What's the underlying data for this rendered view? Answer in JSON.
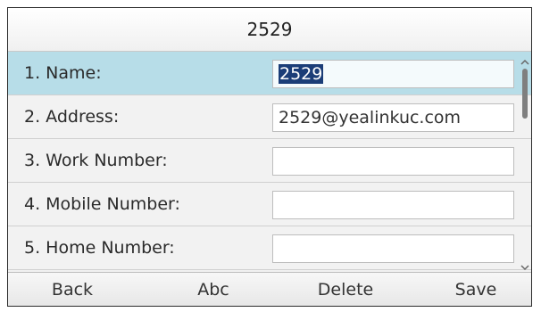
{
  "header": {
    "title": "2529"
  },
  "form": {
    "rows": [
      {
        "label": "1. Name:",
        "value": "2529",
        "selected": true
      },
      {
        "label": "2. Address:",
        "value": "2529@yealinkuc.com"
      },
      {
        "label": "3. Work Number:",
        "value": ""
      },
      {
        "label": "4. Mobile Number:",
        "value": ""
      },
      {
        "label": "5. Home Number:",
        "value": ""
      }
    ]
  },
  "softkeys": {
    "back": "Back",
    "abc": "Abc",
    "delete": "Delete",
    "save": "Save"
  },
  "scroll": {
    "up_icon": "chevron-up-icon",
    "down_icon": "chevron-down-icon"
  },
  "colors": {
    "selected_row": "#b7dde8",
    "text_highlight": "#1b3d77"
  }
}
